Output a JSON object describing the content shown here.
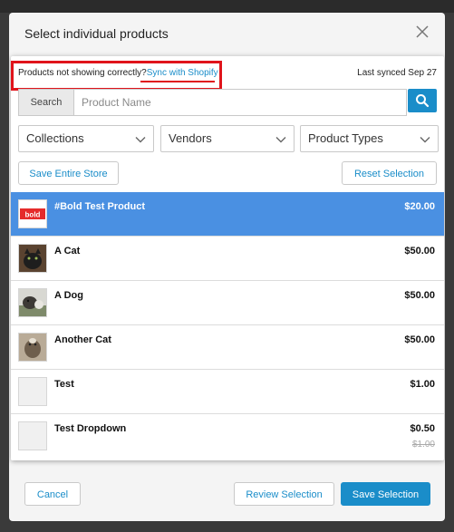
{
  "modal": {
    "title": "Select individual products"
  },
  "sync": {
    "prefix": "Products not showing correctly?",
    "link": "Sync with Shopify",
    "last_synced": "Last synced Sep 27"
  },
  "search": {
    "button_label": "Search",
    "placeholder": "Product Name"
  },
  "filters": [
    "Collections",
    "Vendors",
    "Product Types"
  ],
  "actions": {
    "save_store": "Save Entire Store",
    "reset": "Reset Selection"
  },
  "products": [
    {
      "name": "#Bold Test Product",
      "price": "$20.00",
      "selected": true,
      "thumb": "bold-logo"
    },
    {
      "name": "A Cat",
      "price": "$50.00",
      "thumb": "cat-photo"
    },
    {
      "name": "A Dog",
      "price": "$50.00",
      "thumb": "dog-photo"
    },
    {
      "name": "Another Cat",
      "price": "$50.00",
      "thumb": "cat-photo-2"
    },
    {
      "name": "Test",
      "price": "$1.00",
      "thumb": "placeholder"
    },
    {
      "name": "Test Dropdown",
      "price": "$0.50",
      "compare_price": "$1.00",
      "thumb": "placeholder"
    }
  ],
  "thumb_text": {
    "bold_logo": "bold"
  },
  "footer": {
    "cancel": "Cancel",
    "review": "Review Selection",
    "save": "Save Selection"
  },
  "colors": {
    "accent": "#1a8dc9",
    "selected_row": "#4a90e2",
    "highlight": "#e0141b",
    "bold_logo": "#e52b2b"
  }
}
